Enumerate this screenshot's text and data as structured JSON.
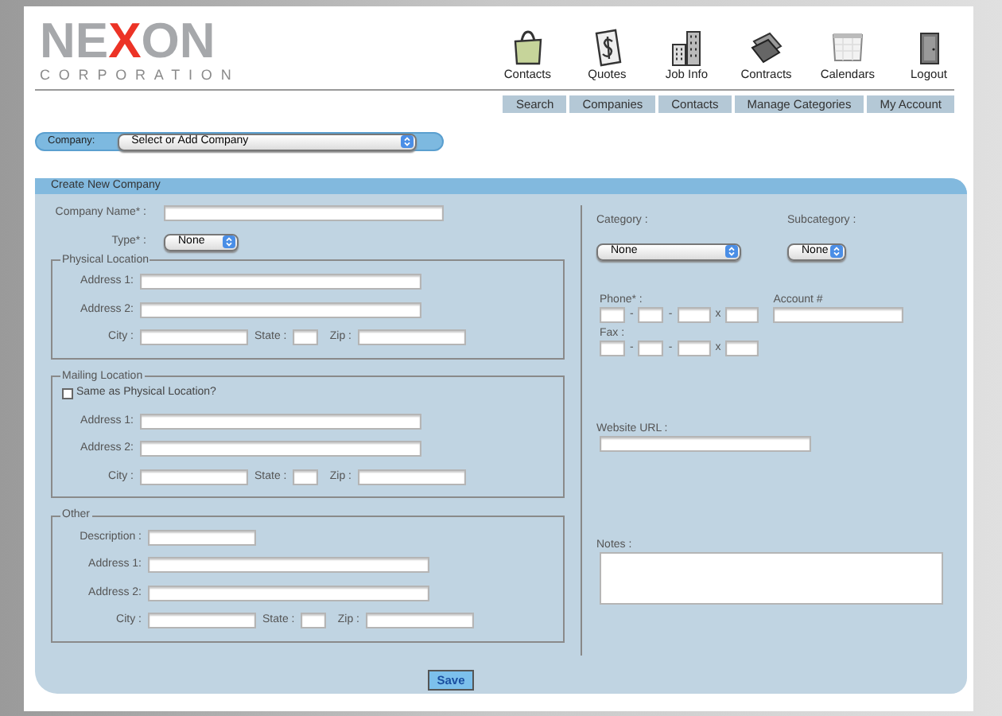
{
  "logo": {
    "parts": [
      {
        "text": "NE",
        "color": "#a6a8ab"
      },
      {
        "text": "X",
        "color": "#ec3326"
      },
      {
        "text": "ON",
        "color": "#a6a8ab"
      }
    ],
    "tagline": "CORPORATION"
  },
  "nav_icons": [
    {
      "kind": "bag",
      "label": "Contacts"
    },
    {
      "kind": "dollar",
      "label": "Quotes"
    },
    {
      "kind": "buildings",
      "label": "Job Info"
    },
    {
      "kind": "folders",
      "label": "Contracts"
    },
    {
      "kind": "calendar",
      "label": "Calendars"
    },
    {
      "kind": "door",
      "label": "Logout"
    }
  ],
  "sub_nav": [
    "Search",
    "Companies",
    "Contacts",
    "Manage Categories",
    "My Account"
  ],
  "company_selector": {
    "label": "Company:",
    "value": "Select or Add Company"
  },
  "form": {
    "title": "Create New Company",
    "company_name": {
      "label": "Company Name* :"
    },
    "type": {
      "label": "Type* :",
      "value": "None"
    },
    "sections": [
      {
        "legend": "Physical Location",
        "rows": [
          {
            "kind": "field",
            "label": "Address 1:"
          },
          {
            "kind": "field",
            "label": "Address 2:"
          },
          {
            "kind": "city_state_zip",
            "labels": [
              "City :",
              "State :",
              "Zip :"
            ]
          }
        ]
      },
      {
        "legend": "Mailing Location",
        "rows": [
          {
            "kind": "checkbox",
            "label": "Same as Physical Location?",
            "checked": false
          },
          {
            "kind": "field",
            "label": "Address 1:"
          },
          {
            "kind": "field",
            "label": "Address 2:"
          },
          {
            "kind": "city_state_zip",
            "labels": [
              "City :",
              "State :",
              "Zip :"
            ]
          }
        ]
      },
      {
        "legend": "Other",
        "rows": [
          {
            "kind": "short_field",
            "label": "Description :"
          },
          {
            "kind": "field",
            "label": "Address 1:"
          },
          {
            "kind": "field",
            "label": "Address 2:"
          },
          {
            "kind": "city_state_zip",
            "labels": [
              "City :",
              "State :",
              "Zip :"
            ]
          }
        ]
      }
    ],
    "category": {
      "label": "Category :",
      "value": "None"
    },
    "subcategory": {
      "label": "Subcategory :",
      "value": "None"
    },
    "phone": {
      "label": "Phone* :",
      "separators": [
        "-",
        "-",
        "x"
      ]
    },
    "account": {
      "label": "Account #"
    },
    "fax": {
      "label": "Fax :",
      "separators": [
        "-",
        "-",
        "x"
      ]
    },
    "website": {
      "label": "Website URL :"
    },
    "notes": {
      "label": "Notes :"
    },
    "save_button": "Save"
  }
}
